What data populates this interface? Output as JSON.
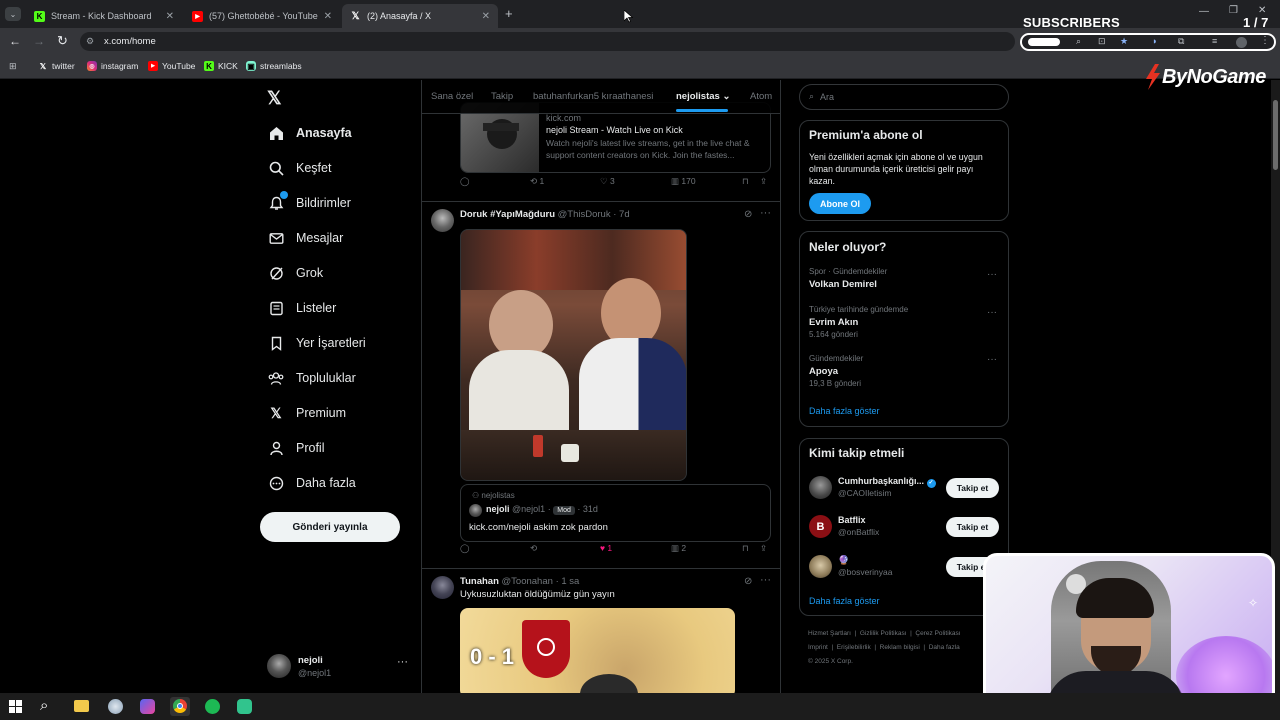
{
  "browser": {
    "tabs": [
      {
        "title": "Stream - Kick Dashboard"
      },
      {
        "title": "(57) Ghettobébé - YouTube"
      },
      {
        "title": "(2) Anasayfa / X"
      }
    ],
    "url": "x.com/home",
    "bookmarks": [
      "twitter",
      "instagram",
      "YouTube",
      "KICK",
      "streamlabs"
    ]
  },
  "overlay": {
    "subscribers_label": "SUBSCRIBERS",
    "subscribers_count": "1 / 7",
    "brand": "ByNoGame"
  },
  "nav": {
    "items": [
      {
        "label": "Anasayfa"
      },
      {
        "label": "Keşfet"
      },
      {
        "label": "Bildirimler"
      },
      {
        "label": "Mesajlar"
      },
      {
        "label": "Grok"
      },
      {
        "label": "Listeler"
      },
      {
        "label": "Yer İşaretleri"
      },
      {
        "label": "Topluluklar"
      },
      {
        "label": "Premium"
      },
      {
        "label": "Profil"
      },
      {
        "label": "Daha fazla"
      }
    ],
    "post_button": "Gönderi yayınla",
    "account": {
      "name": "nejoli",
      "handle": "@nejol1"
    }
  },
  "feed": {
    "tabs": [
      "Sana özel",
      "Takip",
      "batuhanfurkan5 kıraathanesi",
      "nejolistas",
      "Atom"
    ],
    "link_card": {
      "domain": "kick.com",
      "title": "nejoli Stream - Watch Live on Kick",
      "description": "Watch nejoli's latest live streams, get in the live chat & support content creators on Kick. Join the fastes..."
    },
    "post0_actions": {
      "retweets": "1",
      "likes": "3",
      "views": "170"
    },
    "post1": {
      "name": "Doruk #YapıMağduru",
      "handle": "@ThisDoruk",
      "time": "· 7d",
      "quote": {
        "community": "nejolistas",
        "name": "nejoli",
        "handle": "@nejol1",
        "badge": "Mod",
        "time": "· 31d",
        "text": "kick.com/nejoli askim zok pardon"
      },
      "actions": {
        "likes": "1",
        "views": "2"
      }
    },
    "post2": {
      "name": "Tunahan",
      "handle": "@Toonahan",
      "time": "· 1 sa",
      "text": "Uykusuzluktan öldüğümüz gün yayın",
      "image_score": "0 - 1"
    }
  },
  "right": {
    "search_placeholder": "Ara",
    "premium": {
      "title": "Premium'a abone ol",
      "text": "Yeni özellikleri açmak için abone ol ve uygun olman durumunda içerik üreticisi gelir payı kazan.",
      "button": "Abone Ol"
    },
    "trends": {
      "title": "Neler oluyor?",
      "items": [
        {
          "context": "Spor · Gündemdekiler",
          "name": "Volkan Demirel",
          "count": ""
        },
        {
          "context": "Türkiye tarihinde gündemde",
          "name": "Evrim Akın",
          "count": "5.164 gönderi"
        },
        {
          "context": "Gündemdekiler",
          "name": "Apoya",
          "count": "19,3 B gönderi"
        }
      ],
      "more": "Daha fazla göster"
    },
    "who_to_follow": {
      "title": "Kimi takip etmeli",
      "accounts": [
        {
          "name": "Cumhurbaşkanlığı...",
          "handle": "@CAOIletisim",
          "button": "Takip et"
        },
        {
          "name": "Batflix",
          "handle": "@onBatflix",
          "button": "Takip et"
        },
        {
          "name": "🔮",
          "handle": "@bosverinyaa",
          "button": "Takip et"
        }
      ],
      "more": "Daha fazla göster"
    },
    "footer": {
      "links": [
        "Hizmet Şartları",
        "Gizlilik Politikası",
        "Çerez Politikası",
        "Imprint",
        "Erişilebilirlik",
        "Reklam bilgisi",
        "Daha fazla"
      ],
      "copyright": "© 2025 X Corp."
    }
  },
  "colors": {
    "accent": "#1d9bf0",
    "background": "#000000",
    "border": "#2f3336",
    "muted": "#71767b"
  }
}
